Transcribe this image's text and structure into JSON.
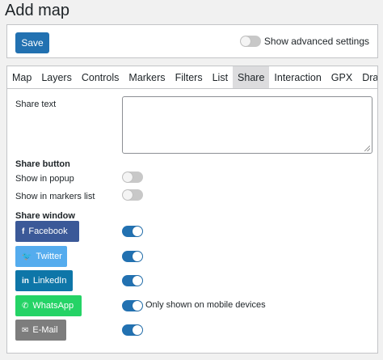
{
  "page": {
    "title": "Add map"
  },
  "toolbar": {
    "save_label": "Save",
    "advanced_label": "Show advanced settings",
    "advanced_on": false
  },
  "tabs": [
    {
      "label": "Map",
      "active": false
    },
    {
      "label": "Layers",
      "active": false
    },
    {
      "label": "Controls",
      "active": false
    },
    {
      "label": "Markers",
      "active": false
    },
    {
      "label": "Filters",
      "active": false
    },
    {
      "label": "List",
      "active": false
    },
    {
      "label": "Share",
      "active": true
    },
    {
      "label": "Interaction",
      "active": false
    },
    {
      "label": "GPX",
      "active": false
    },
    {
      "label": "Draw",
      "active": false
    }
  ],
  "share": {
    "share_text_label": "Share text",
    "share_text_value": "",
    "button_section": "Share button",
    "show_in_popup_label": "Show in popup",
    "show_in_popup_on": false,
    "show_in_list_label": "Show in markers list",
    "show_in_list_on": false,
    "window_section": "Share window",
    "networks": [
      {
        "label": "Facebook",
        "icon": "facebook-icon",
        "glyph": "f",
        "color": "#3b5998",
        "enabled": true
      },
      {
        "label": "Twitter",
        "icon": "twitter-bird-icon",
        "glyph": "🐦",
        "color": "#55acee",
        "enabled": true
      },
      {
        "label": "LinkedIn",
        "icon": "linkedin-icon",
        "glyph": "in",
        "color": "#0e76a8",
        "enabled": true
      },
      {
        "label": "WhatsApp",
        "icon": "whatsapp-icon",
        "glyph": "✆",
        "color": "#25d366",
        "enabled": true,
        "note": "Only shown on mobile devices"
      },
      {
        "label": "E-Mail",
        "icon": "envelope-icon",
        "glyph": "✉",
        "color": "#7d7d7d",
        "enabled": true
      }
    ]
  }
}
